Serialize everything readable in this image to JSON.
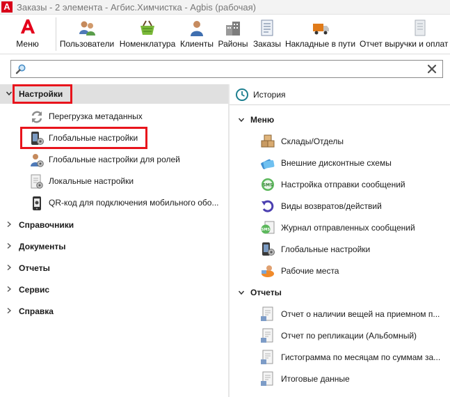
{
  "window": {
    "title": "Заказы - 2 элемента - Агбис.Химчистка - Agbis (рабочая)",
    "app_logo_letter": "A"
  },
  "ribbon": {
    "menu_label": "Меню",
    "buttons": [
      {
        "label": "Пользователи",
        "icon": "users-icon"
      },
      {
        "label": "Номенклатура",
        "icon": "basket-icon"
      },
      {
        "label": "Клиенты",
        "icon": "client-icon"
      },
      {
        "label": "Районы",
        "icon": "buildings-icon"
      },
      {
        "label": "Заказы",
        "icon": "document-icon"
      },
      {
        "label": "Накладные в пути",
        "icon": "truck-icon"
      },
      {
        "label": "Отчет выручки и оплат",
        "icon": "report-icon"
      }
    ]
  },
  "search": {
    "value": "",
    "placeholder": ""
  },
  "tree": {
    "settings": {
      "label": "Настройки",
      "children": [
        {
          "label": "Перегрузка метаданных",
          "icon": "reload-icon"
        },
        {
          "label": "Глобальные настройки",
          "icon": "phone-gear-icon"
        },
        {
          "label": "Глобальные настройки для ролей",
          "icon": "user-gear-icon"
        },
        {
          "label": "Локальные настройки",
          "icon": "file-gear-icon"
        },
        {
          "label": "QR-код для подключения мобильного обо...",
          "icon": "mobile-icon"
        }
      ]
    },
    "sections": [
      {
        "label": "Справочники"
      },
      {
        "label": "Документы"
      },
      {
        "label": "Отчеты"
      },
      {
        "label": "Сервис"
      },
      {
        "label": "Справка"
      }
    ]
  },
  "right": {
    "history_label": "История",
    "menu_group": {
      "label": "Меню",
      "items": [
        {
          "label": "Склады/Отделы",
          "icon": "boxes-icon"
        },
        {
          "label": "Внешние дисконтные схемы",
          "icon": "cards-icon"
        },
        {
          "label": "Настройка отправки сообщений",
          "icon": "sms-icon"
        },
        {
          "label": "Виды возвратов/действий",
          "icon": "return-icon"
        },
        {
          "label": "Журнал отправленных сообщений",
          "icon": "sms-log-icon"
        },
        {
          "label": "Глобальные настройки",
          "icon": "phone-gear-icon"
        },
        {
          "label": "Рабочие места",
          "icon": "workplace-icon"
        }
      ]
    },
    "reports_group": {
      "label": "Отчеты",
      "items": [
        {
          "label": "Отчет о наличии вещей на приемном п...",
          "icon": "report-doc-icon"
        },
        {
          "label": "Отчет по репликации (Альбомный)",
          "icon": "report-doc-icon"
        },
        {
          "label": "Гистограмма по месяцам по суммам за...",
          "icon": "report-doc-icon"
        },
        {
          "label": "Итоговые данные",
          "icon": "report-doc-icon"
        }
      ]
    }
  },
  "colors": {
    "accent_red": "#e8141c",
    "selection": "#e0e0e0"
  }
}
